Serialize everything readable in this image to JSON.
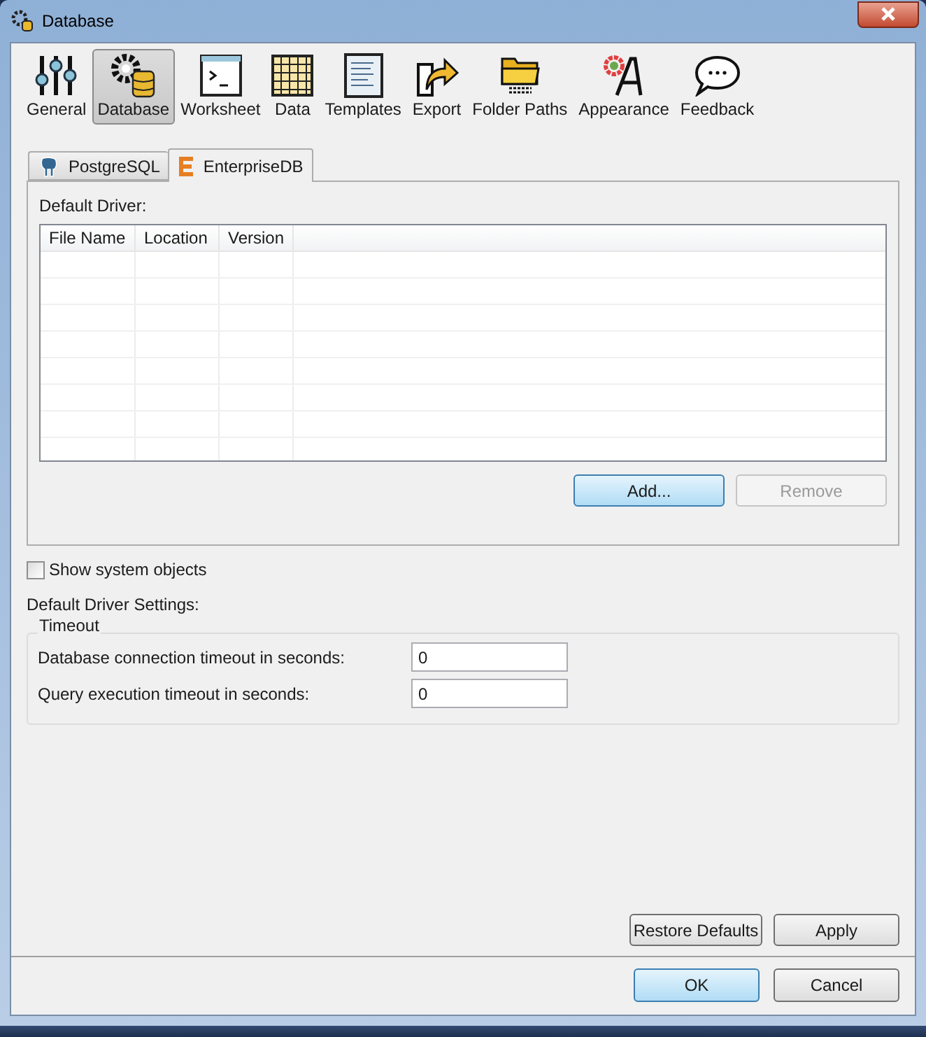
{
  "window": {
    "title": "Database"
  },
  "toolbar": [
    {
      "label": "General",
      "selected": false
    },
    {
      "label": "Database",
      "selected": true
    },
    {
      "label": "Worksheet",
      "selected": false
    },
    {
      "label": "Data",
      "selected": false
    },
    {
      "label": "Templates",
      "selected": false
    },
    {
      "label": "Export",
      "selected": false
    },
    {
      "label": "Folder Paths",
      "selected": false
    },
    {
      "label": "Appearance",
      "selected": false
    },
    {
      "label": "Feedback",
      "selected": false
    }
  ],
  "tabs": [
    {
      "label": "PostgreSQL",
      "selected": false
    },
    {
      "label": "EnterpriseDB",
      "selected": true
    }
  ],
  "driver_panel": {
    "label": "Default Driver:",
    "table": {
      "columns": [
        "File Name",
        "Location",
        "Version"
      ]
    },
    "buttons": [
      {
        "label": "Add...",
        "highlighted": true,
        "disabled": false
      },
      {
        "label": "Remove",
        "disabled": true
      }
    ]
  },
  "show_system_objects": {
    "label": "Show system objects",
    "checked": false
  },
  "settings_label": "Default Driver Settings:",
  "timeout_group": {
    "title": "Timeout",
    "fields": [
      {
        "label": "Database connection timeout in seconds:",
        "value": "0"
      },
      {
        "label": "Query execution timeout in seconds:",
        "value": "0"
      }
    ]
  },
  "page_buttons": [
    {
      "label": "Restore Defaults",
      "highlighted": false
    },
    {
      "label": "Apply",
      "highlighted": false
    }
  ],
  "dialog_buttons": [
    {
      "label": "OK",
      "highlighted": true
    },
    {
      "label": "Cancel",
      "highlighted": false
    }
  ]
}
